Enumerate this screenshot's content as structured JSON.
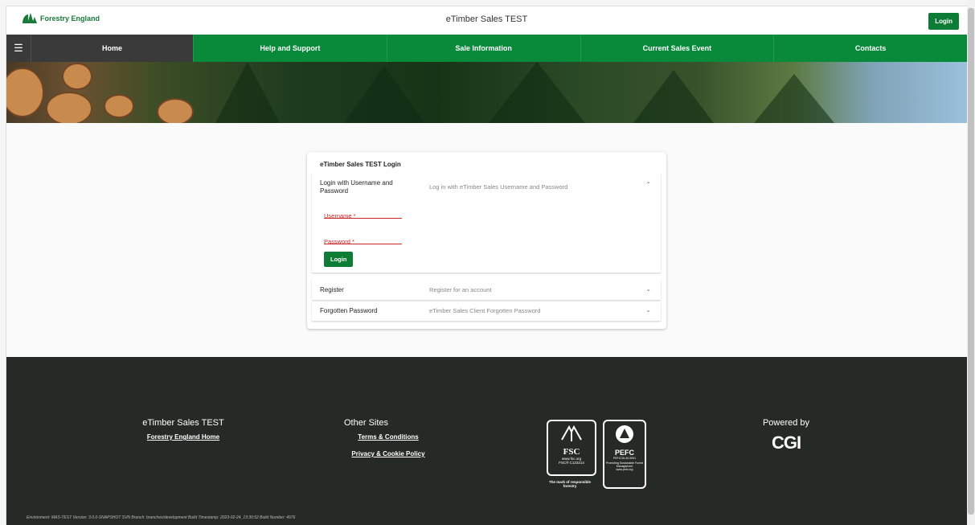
{
  "header": {
    "brand": "Forestry England",
    "title": "eTimber Sales TEST",
    "login_label": "Login"
  },
  "nav": {
    "items": [
      "Home",
      "Help and Support",
      "Sale Information",
      "Current Sales Event",
      "Contacts"
    ]
  },
  "login_card": {
    "title": "eTimber Sales TEST Login",
    "panels": [
      {
        "title": "Login with Username and Password",
        "desc": "Log in with eTimber Sales Username and Password"
      },
      {
        "title": "Register",
        "desc": "Register for an account"
      },
      {
        "title": "Forgotten Password",
        "desc": "eTimber Sales Client Forgotten Password"
      }
    ],
    "username_label": "Username *",
    "password_label": "Password *",
    "login_label": "Login"
  },
  "footer": {
    "col1_title": "eTimber Sales TEST",
    "col1_link": "Forestry England Home",
    "col2_title": "Other Sites",
    "col2_links": [
      "Terms & Conditions",
      "Privacy & Cookie Policy"
    ],
    "fsc": {
      "name": "FSC",
      "url": "www.fsc.org",
      "code": "FSC® C123214",
      "tag": "The mark of responsible forestry"
    },
    "pefc": {
      "name": "PEFC",
      "code": "PEFC/16-40-9001",
      "tag": "Promoting Sustainable Forest Management",
      "url": "www.pefc.org"
    },
    "powered_by": "Powered by",
    "powered_logo": "CGI",
    "env": "Environment: MAS-TEST Version: 3.0.0-SNAPSHOT SVN Branch: branches/development Build Timestamp: 2023-02-24_13:30:52 Build Number: 4976"
  },
  "colors": {
    "green": "#098a3a",
    "footer": "#262a27",
    "error": "#c62828"
  }
}
